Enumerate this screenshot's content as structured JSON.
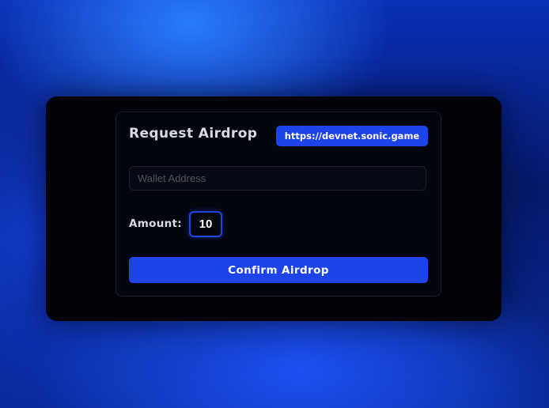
{
  "airdrop_form": {
    "title": "Request Airdrop",
    "network_url": "https://devnet.sonic.game",
    "wallet_address": {
      "value": "",
      "placeholder": "Wallet Address"
    },
    "amount": {
      "label": "Amount:",
      "value": "10"
    },
    "confirm_label": "Confirm Airdrop"
  },
  "colors": {
    "accent": "#1d44e8",
    "card_background": "#010309",
    "text": "#d7dae3"
  }
}
